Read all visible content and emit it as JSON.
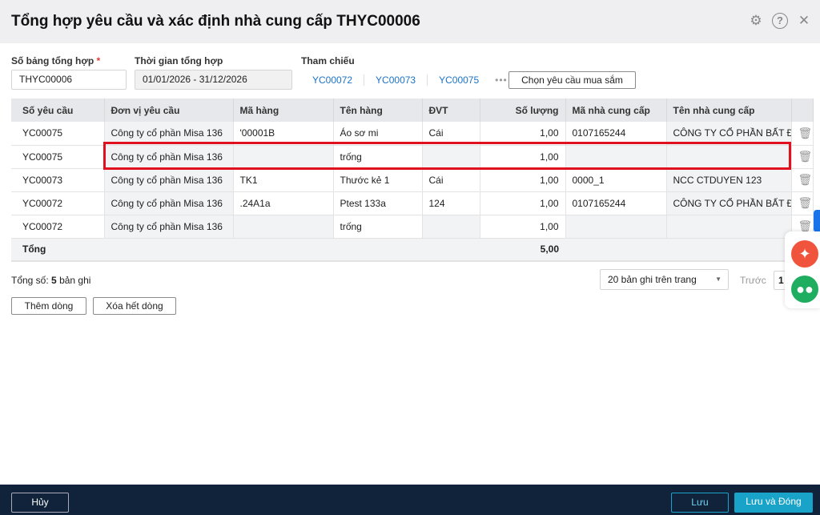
{
  "title": "Tổng hợp yêu cầu và xác định nhà cung cấp THYC00006",
  "form": {
    "code_label": "Số bảng tổng hợp",
    "required_mark": "*",
    "code_value": "THYC00006",
    "period_label": "Thời gian tổng hợp",
    "period_value": "01/01/2026 - 31/12/2026",
    "ref_label": "Tham chiếu",
    "refs": [
      "YC00072",
      "YC00073",
      "YC00075"
    ],
    "more": "•••",
    "choose_button": "Chọn yêu cầu mua sắm"
  },
  "table": {
    "headers": [
      "Số yêu cầu",
      "Đơn vị yêu cầu",
      "Mã hàng",
      "Tên hàng",
      "ĐVT",
      "Số lượng",
      "Mã nhà cung cấp",
      "Tên nhà cung cấp"
    ],
    "rows": [
      [
        "YC00075",
        "Công ty cổ phần Misa 136",
        "'00001B",
        "Áo sơ mi",
        "Cái",
        "1,00",
        "0107165244",
        "CÔNG TY CỔ PHẦN BẤT ĐỘNG SẢN"
      ],
      [
        "YC00075",
        "Công ty cổ phần Misa 136",
        "",
        "trống",
        "",
        "1,00",
        "",
        ""
      ],
      [
        "YC00073",
        "Công ty cổ phần Misa 136",
        "TK1",
        "Thước kẻ 1",
        "Cái",
        "1,00",
        "0000_1",
        "NCC CTDUYEN 123"
      ],
      [
        "YC00072",
        "Công ty cổ phần Misa 136",
        ".24A1a",
        "Ptest 133a",
        "124",
        "1,00",
        "0107165244",
        "CÔNG TY CỔ PHẦN BẤT ĐỘNG SẢN"
      ],
      [
        "YC00072",
        "Công ty cổ phần Misa 136",
        "",
        "trống",
        "",
        "1,00",
        "",
        ""
      ]
    ],
    "total_label": "Tổng",
    "total_value": "5,00"
  },
  "summary": {
    "prefix": "Tổng số:",
    "count": "5",
    "suffix": "bản ghi"
  },
  "pagination": {
    "page_size": "20 bản ghi trên trang",
    "prev": "Trước",
    "page": "1"
  },
  "actions": {
    "add_row": "Thêm dòng",
    "clear_rows": "Xóa hết dòng"
  },
  "footer": {
    "cancel": "Hủy",
    "save": "Lưu",
    "save_close": "Lưu và Đóng"
  },
  "colors": {
    "accent": "#1a73c8",
    "footer": "#10233a",
    "highlight": "#e0101e",
    "primary_button": "#1aa3c8"
  }
}
